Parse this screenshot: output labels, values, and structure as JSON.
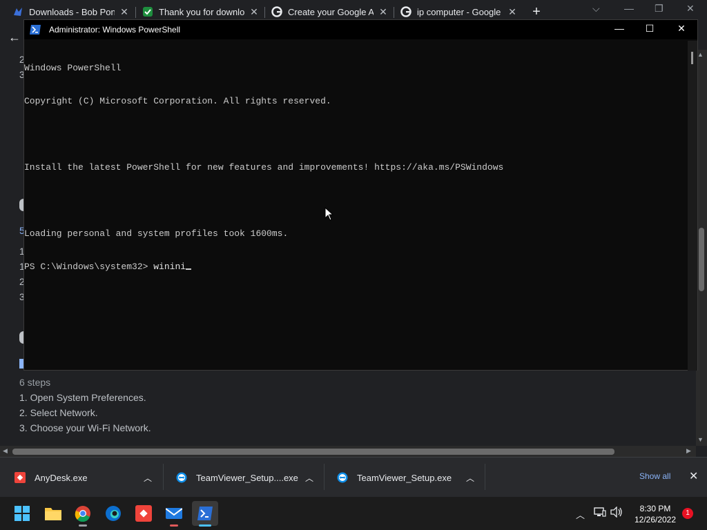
{
  "browser": {
    "tabs": [
      {
        "title": "Downloads - Bob Pony",
        "icon": "bob-pony-icon"
      },
      {
        "title": "Thank you for downloa",
        "icon": "download-check-icon"
      },
      {
        "title": "Create your Google Ac",
        "icon": "google-icon"
      },
      {
        "title": "ip computer - Google S",
        "icon": "google-icon"
      }
    ],
    "new_tab": "+",
    "back": "←"
  },
  "webpage": {
    "peek_numbers": [
      "2",
      "3",
      "5",
      "1",
      "1",
      "2",
      "3"
    ],
    "steps_label": "6 steps",
    "steps": [
      "1.  Open System Preferences.",
      "2.  Select Network.",
      "3.  Choose your Wi-Fi Network."
    ]
  },
  "powershell": {
    "window_title": "Administrator: Windows PowerShell",
    "lines": [
      "Windows PowerShell",
      "Copyright (C) Microsoft Corporation. All rights reserved.",
      "",
      "Install the latest PowerShell for new features and improvements! https://aka.ms/PSWindows",
      "",
      "Loading personal and system profiles took 1600ms."
    ],
    "prompt": "PS C:\\Windows\\system32> ",
    "typed": "winini"
  },
  "downloads": {
    "items": [
      {
        "name": "AnyDesk.exe",
        "icon": "anydesk-icon"
      },
      {
        "name": "TeamViewer_Setup....exe",
        "icon": "teamviewer-icon"
      },
      {
        "name": "TeamViewer_Setup.exe",
        "icon": "teamviewer-icon"
      }
    ],
    "show_all": "Show all"
  },
  "taskbar": {
    "time": "8:30 PM",
    "date": "12/26/2022",
    "notification_count": "1"
  }
}
